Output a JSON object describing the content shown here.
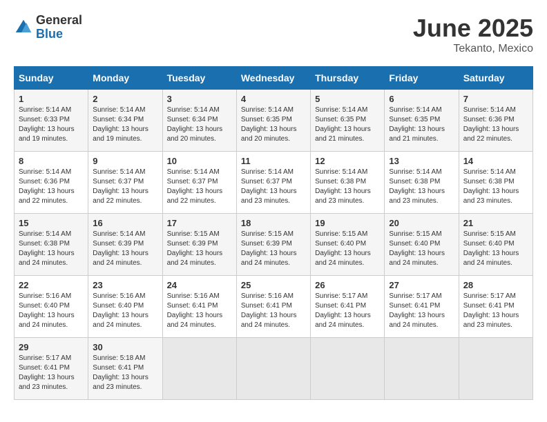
{
  "header": {
    "logo_general": "General",
    "logo_blue": "Blue",
    "month_year": "June 2025",
    "location": "Tekanto, Mexico"
  },
  "calendar": {
    "days_of_week": [
      "Sunday",
      "Monday",
      "Tuesday",
      "Wednesday",
      "Thursday",
      "Friday",
      "Saturday"
    ],
    "weeks": [
      [
        {
          "day": "",
          "empty": true
        },
        {
          "day": "",
          "empty": true
        },
        {
          "day": "",
          "empty": true
        },
        {
          "day": "",
          "empty": true
        },
        {
          "day": "",
          "empty": true
        },
        {
          "day": "",
          "empty": true
        },
        {
          "day": "",
          "empty": true
        }
      ],
      [
        {
          "day": "1",
          "sunrise": "5:14 AM",
          "sunset": "6:33 PM",
          "daylight": "13 hours and 19 minutes."
        },
        {
          "day": "2",
          "sunrise": "5:14 AM",
          "sunset": "6:34 PM",
          "daylight": "13 hours and 19 minutes."
        },
        {
          "day": "3",
          "sunrise": "5:14 AM",
          "sunset": "6:34 PM",
          "daylight": "13 hours and 20 minutes."
        },
        {
          "day": "4",
          "sunrise": "5:14 AM",
          "sunset": "6:35 PM",
          "daylight": "13 hours and 20 minutes."
        },
        {
          "day": "5",
          "sunrise": "5:14 AM",
          "sunset": "6:35 PM",
          "daylight": "13 hours and 21 minutes."
        },
        {
          "day": "6",
          "sunrise": "5:14 AM",
          "sunset": "6:35 PM",
          "daylight": "13 hours and 21 minutes."
        },
        {
          "day": "7",
          "sunrise": "5:14 AM",
          "sunset": "6:36 PM",
          "daylight": "13 hours and 22 minutes."
        }
      ],
      [
        {
          "day": "8",
          "sunrise": "5:14 AM",
          "sunset": "6:36 PM",
          "daylight": "13 hours and 22 minutes."
        },
        {
          "day": "9",
          "sunrise": "5:14 AM",
          "sunset": "6:37 PM",
          "daylight": "13 hours and 22 minutes."
        },
        {
          "day": "10",
          "sunrise": "5:14 AM",
          "sunset": "6:37 PM",
          "daylight": "13 hours and 22 minutes."
        },
        {
          "day": "11",
          "sunrise": "5:14 AM",
          "sunset": "6:37 PM",
          "daylight": "13 hours and 23 minutes."
        },
        {
          "day": "12",
          "sunrise": "5:14 AM",
          "sunset": "6:38 PM",
          "daylight": "13 hours and 23 minutes."
        },
        {
          "day": "13",
          "sunrise": "5:14 AM",
          "sunset": "6:38 PM",
          "daylight": "13 hours and 23 minutes."
        },
        {
          "day": "14",
          "sunrise": "5:14 AM",
          "sunset": "6:38 PM",
          "daylight": "13 hours and 23 minutes."
        }
      ],
      [
        {
          "day": "15",
          "sunrise": "5:14 AM",
          "sunset": "6:38 PM",
          "daylight": "13 hours and 24 minutes."
        },
        {
          "day": "16",
          "sunrise": "5:14 AM",
          "sunset": "6:39 PM",
          "daylight": "13 hours and 24 minutes."
        },
        {
          "day": "17",
          "sunrise": "5:15 AM",
          "sunset": "6:39 PM",
          "daylight": "13 hours and 24 minutes."
        },
        {
          "day": "18",
          "sunrise": "5:15 AM",
          "sunset": "6:39 PM",
          "daylight": "13 hours and 24 minutes."
        },
        {
          "day": "19",
          "sunrise": "5:15 AM",
          "sunset": "6:40 PM",
          "daylight": "13 hours and 24 minutes."
        },
        {
          "day": "20",
          "sunrise": "5:15 AM",
          "sunset": "6:40 PM",
          "daylight": "13 hours and 24 minutes."
        },
        {
          "day": "21",
          "sunrise": "5:15 AM",
          "sunset": "6:40 PM",
          "daylight": "13 hours and 24 minutes."
        }
      ],
      [
        {
          "day": "22",
          "sunrise": "5:16 AM",
          "sunset": "6:40 PM",
          "daylight": "13 hours and 24 minutes."
        },
        {
          "day": "23",
          "sunrise": "5:16 AM",
          "sunset": "6:40 PM",
          "daylight": "13 hours and 24 minutes."
        },
        {
          "day": "24",
          "sunrise": "5:16 AM",
          "sunset": "6:41 PM",
          "daylight": "13 hours and 24 minutes."
        },
        {
          "day": "25",
          "sunrise": "5:16 AM",
          "sunset": "6:41 PM",
          "daylight": "13 hours and 24 minutes."
        },
        {
          "day": "26",
          "sunrise": "5:17 AM",
          "sunset": "6:41 PM",
          "daylight": "13 hours and 24 minutes."
        },
        {
          "day": "27",
          "sunrise": "5:17 AM",
          "sunset": "6:41 PM",
          "daylight": "13 hours and 24 minutes."
        },
        {
          "day": "28",
          "sunrise": "5:17 AM",
          "sunset": "6:41 PM",
          "daylight": "13 hours and 23 minutes."
        }
      ],
      [
        {
          "day": "29",
          "sunrise": "5:17 AM",
          "sunset": "6:41 PM",
          "daylight": "13 hours and 23 minutes."
        },
        {
          "day": "30",
          "sunrise": "5:18 AM",
          "sunset": "6:41 PM",
          "daylight": "13 hours and 23 minutes."
        },
        {
          "day": "",
          "empty": true
        },
        {
          "day": "",
          "empty": true
        },
        {
          "day": "",
          "empty": true
        },
        {
          "day": "",
          "empty": true
        },
        {
          "day": "",
          "empty": true
        }
      ]
    ]
  }
}
